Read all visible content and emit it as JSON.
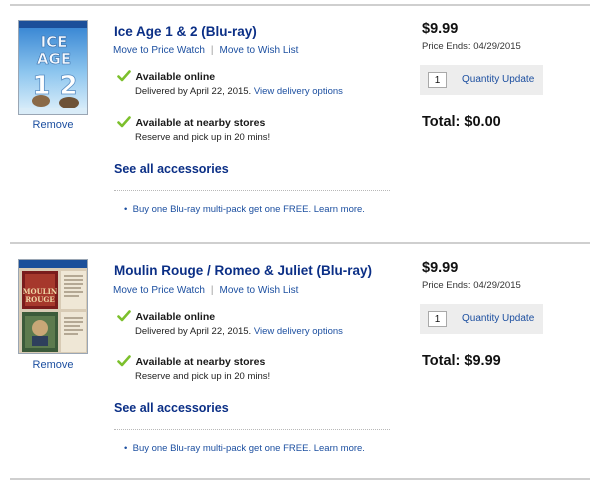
{
  "items": [
    {
      "cover_art": "Ice Age 1 & 2",
      "title": "Ice Age 1 & 2 (Blu-ray)",
      "move_price_watch": "Move to Price Watch",
      "move_wish_list": "Move to Wish List",
      "available_online": "Available online",
      "delivered_by": "Delivered by April 22, 2015.",
      "delivery_options": "View delivery options",
      "available_stores": "Available at nearby stores",
      "pickup": "Reserve and pick up in 20 mins!",
      "accessories": "See all accessories",
      "promo": "Buy one Blu-ray multi-pack get one FREE. Learn more.",
      "remove": "Remove",
      "price": "$9.99",
      "price_ends": "Price Ends: 04/29/2015",
      "quantity": "1",
      "quantity_update": "Quantity Update",
      "total_label": "Total:",
      "total_value": "$0.00"
    },
    {
      "cover_art": "Moulin Rouge / Romeo & Juliet",
      "title": "Moulin Rouge / Romeo & Juliet (Blu-ray)",
      "move_price_watch": "Move to Price Watch",
      "move_wish_list": "Move to Wish List",
      "available_online": "Available online",
      "delivered_by": "Delivered by April 22, 2015.",
      "delivery_options": "View delivery options",
      "available_stores": "Available at nearby stores",
      "pickup": "Reserve and pick up in 20 mins!",
      "accessories": "See all accessories",
      "promo": "Buy one Blu-ray multi-pack get one FREE. Learn more.",
      "remove": "Remove",
      "price": "$9.99",
      "price_ends": "Price Ends: 04/29/2015",
      "quantity": "1",
      "quantity_update": "Quantity Update",
      "total_label": "Total:",
      "total_value": "$9.99"
    }
  ],
  "icons": {
    "check": "check-icon",
    "bullet": "bullet-icon"
  },
  "colors": {
    "link": "#1c4fa0",
    "title": "#0b2f86",
    "check": "#7cc02c",
    "qty_bg": "#ededed",
    "divider": "#cfcfcf"
  }
}
